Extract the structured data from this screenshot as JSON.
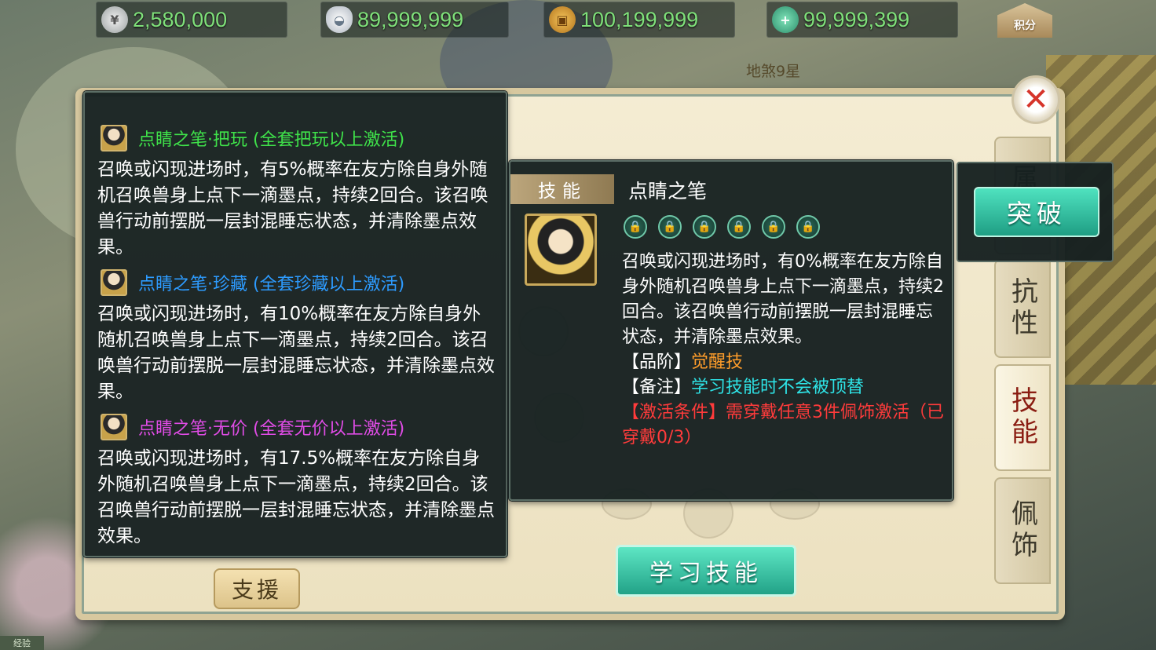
{
  "currencies": [
    {
      "icon": "silver-coin-icon",
      "value": "2,580,000"
    },
    {
      "icon": "silver-ingot-icon",
      "value": "89,999,999"
    },
    {
      "icon": "copper-coin-icon",
      "value": "100,199,999"
    },
    {
      "icon": "jade-plus-icon",
      "value": "99,999,399"
    }
  ],
  "score_button": {
    "label": "积分"
  },
  "background_name": "地煞9星",
  "tooltip_tiers": [
    {
      "title": "点睛之笔·把玩 (全套把玩以上激活)",
      "color": "#3fe24a",
      "desc": "召唤或闪现进场时，有5%概率在友方除自身外随机召唤兽身上点下一滴墨点，持续2回合。该召唤兽行动前摆脱一层封混睡忘状态，并清除墨点效果。"
    },
    {
      "title": "点睛之笔·珍藏 (全套珍藏以上激活)",
      "color": "#2d9bff",
      "desc": "召唤或闪现进场时，有10%概率在友方除自身外随机召唤兽身上点下一滴墨点，持续2回合。该召唤兽行动前摆脱一层封混睡忘状态，并清除墨点效果。"
    },
    {
      "title": "点睛之笔·无价 (全套无价以上激活)",
      "color": "#e04ce6",
      "desc": "召唤或闪现进场时，有17.5%概率在友方除自身外随机召唤兽身上点下一滴墨点，持续2回合。该召唤兽行动前摆脱一层封混睡忘状态，并清除墨点效果。"
    }
  ],
  "skill": {
    "tag": "技能",
    "name": "点睛之笔",
    "lock_count": 6,
    "desc": "召唤或闪现进场时，有0%概率在友方除自身外随机召唤兽身上点下一滴墨点，持续2回合。该召唤兽行动前摆脱一层封混睡忘状态，并清除墨点效果。",
    "grade_label": "【品阶】",
    "grade_value": "觉醒技",
    "note_label": "【备注】",
    "note_value": "学习技能时不会被顶替",
    "activation": "【激活条件】需穿戴任意3件佩饰激活（已穿戴0/3）"
  },
  "buttons": {
    "breakthrough": "突破",
    "learn": "学习技能",
    "support": "支援",
    "close": "✕"
  },
  "side_tabs": [
    {
      "label": "属性",
      "active": false
    },
    {
      "label": "抗性",
      "active": false
    },
    {
      "label": "技能",
      "active": true
    },
    {
      "label": "佩饰",
      "active": false
    }
  ],
  "exp_label": "经验"
}
